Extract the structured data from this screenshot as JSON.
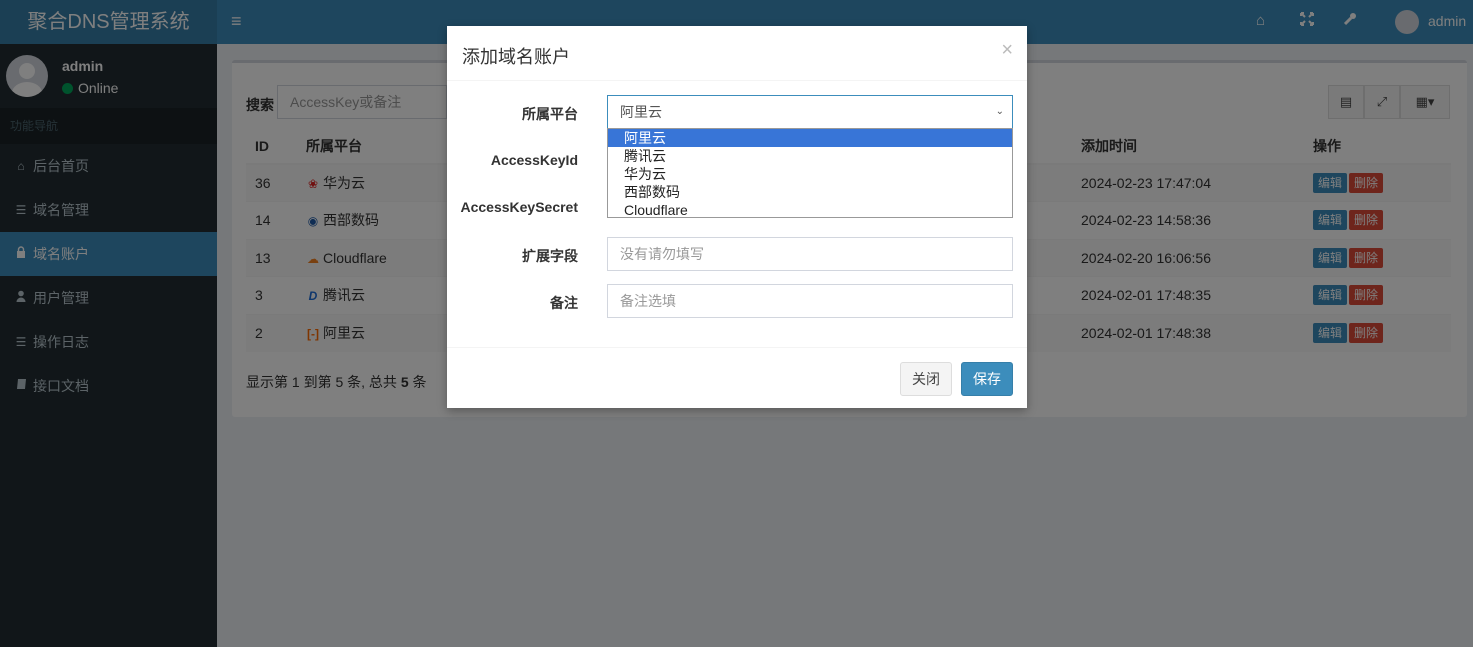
{
  "app": {
    "title": "聚合DNS管理系统"
  },
  "user": {
    "name": "admin",
    "status": "Online"
  },
  "sidebar": {
    "header": "功能导航",
    "items": [
      {
        "label": "后台首页",
        "icon": "home-icon"
      },
      {
        "label": "域名管理",
        "icon": "list-icon"
      },
      {
        "label": "域名账户",
        "icon": "lock-icon",
        "active": true
      },
      {
        "label": "用户管理",
        "icon": "user-icon"
      },
      {
        "label": "操作日志",
        "icon": "list-icon"
      },
      {
        "label": "接口文档",
        "icon": "book-icon"
      }
    ]
  },
  "topbar": {
    "toggle_icon": "menu-icon",
    "icons": [
      "home-icon",
      "fullscreen-icon",
      "wrench-icon"
    ],
    "user": "admin"
  },
  "search": {
    "label": "搜索",
    "placeholder": "AccessKey或备注"
  },
  "table": {
    "columns": [
      "ID",
      "所属平台",
      "添加时间",
      "操作"
    ],
    "rows": [
      {
        "id": "36",
        "platform": "华为云",
        "platform_icon": "huawei-icon",
        "time": "2024-02-23 17:47:04"
      },
      {
        "id": "14",
        "platform": "西部数码",
        "platform_icon": "west-icon",
        "time": "2024-02-23 14:58:36"
      },
      {
        "id": "13",
        "platform": "Cloudflare",
        "platform_icon": "cloudflare-icon",
        "time": "2024-02-20 16:06:56"
      },
      {
        "id": "3",
        "platform": "腾讯云",
        "platform_icon": "dnspod-icon",
        "time": "2024-02-01 17:48:35"
      },
      {
        "id": "2",
        "platform": "阿里云",
        "platform_icon": "aliyun-icon",
        "time": "2024-02-01 17:48:38"
      }
    ],
    "edit_label": "编辑",
    "delete_label": "删除",
    "footer": {
      "prefix": "显示第 1 到第 5 条, 总共 ",
      "total": "5",
      "suffix": " 条"
    }
  },
  "modal": {
    "title": "添加域名账户",
    "close_glyph": "×",
    "fields": {
      "platform": {
        "label": "所属平台",
        "value": "阿里云"
      },
      "access_key_id": {
        "label": "AccessKeyId"
      },
      "access_key_secret": {
        "label": "AccessKeySecret"
      },
      "ext": {
        "label": "扩展字段",
        "placeholder": "没有请勿填写"
      },
      "remark": {
        "label": "备注",
        "placeholder": "备注选填"
      }
    },
    "dropdown_options": [
      "阿里云",
      "腾讯云",
      "华为云",
      "西部数码",
      "Cloudflare"
    ],
    "close_button": "关闭",
    "save_button": "保存"
  }
}
